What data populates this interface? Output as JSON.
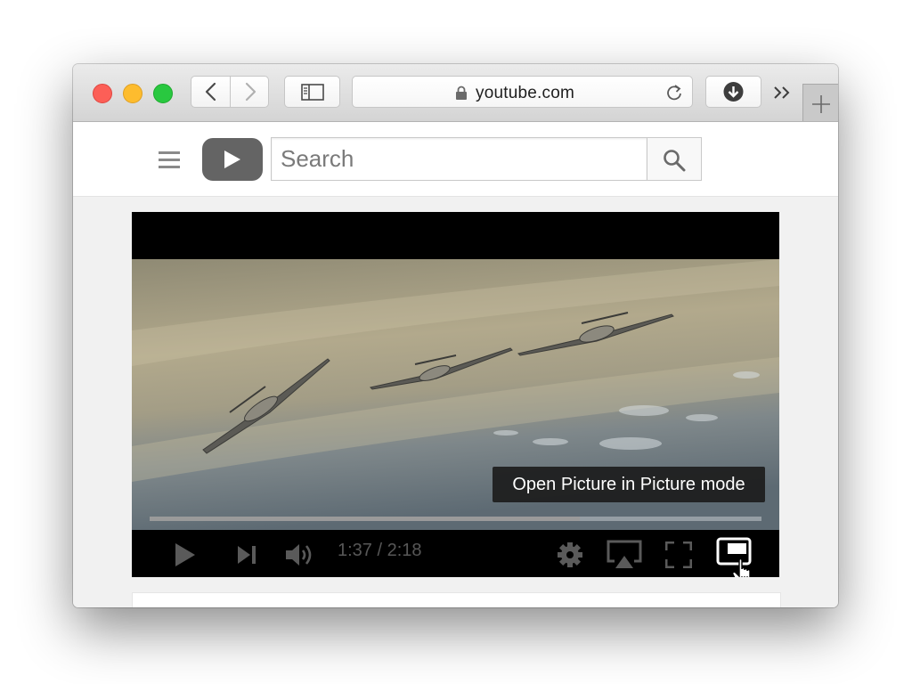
{
  "browser": {
    "url": "youtube.com",
    "controls": {
      "back_icon": "chevron-left-icon",
      "forward_icon": "chevron-right-icon",
      "sidebar_icon": "sidebar-icon",
      "lock_icon": "lock-icon",
      "reload_icon": "reload-icon",
      "download_icon": "download-icon",
      "overflow_icon": "double-chevron-right-icon",
      "new_tab_icon": "plus-icon"
    },
    "colors": {
      "close": "#fc5f57",
      "minimize": "#fdbc2e",
      "zoom": "#29c840"
    }
  },
  "youtube": {
    "menu_icon": "hamburger-icon",
    "logo_icon": "youtube-play-logo",
    "search": {
      "placeholder": "Search",
      "button_icon": "search-icon"
    }
  },
  "player": {
    "tooltip": "Open Picture in Picture mode",
    "time_display": "1:37 / 2:18",
    "progress_fraction": 0.703,
    "control_icons": [
      "play-icon",
      "skip-next-icon",
      "volume-icon",
      "gear-icon",
      "airplay-icon",
      "fullscreen-icon",
      "picture-in-picture-icon"
    ]
  }
}
